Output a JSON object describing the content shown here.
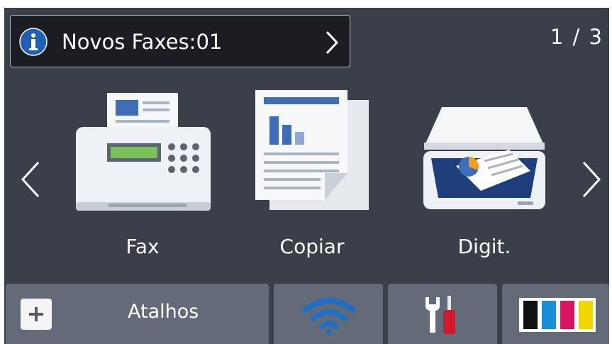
{
  "notification": {
    "text": "Novos Faxes:01",
    "icon": "info-icon",
    "chevron": "chevron-right-icon"
  },
  "pager": {
    "indicator": "1 / 3"
  },
  "functions": [
    {
      "label": "Fax",
      "icon": "fax-machine-icon"
    },
    {
      "label": "Copiar",
      "icon": "copy-document-icon"
    },
    {
      "label": "Digit.",
      "icon": "scanner-icon"
    }
  ],
  "bottom_bar": {
    "shortcuts_label": "Atalhos",
    "shortcuts_icon": "plus-icon",
    "wifi_icon": "wifi-icon",
    "tools_icon": "tools-icon",
    "ink_icon": "ink-cartridge-icon"
  },
  "colors": {
    "background": "#3a3f4a",
    "notify_bg": "#1b1d22",
    "button_bg": "#646b78",
    "wifi_blue": "#1f6fc4",
    "ink_black": "#111111",
    "ink_cyan": "#1a8fd8",
    "ink_magenta": "#d8145e",
    "ink_yellow": "#f2d600"
  }
}
